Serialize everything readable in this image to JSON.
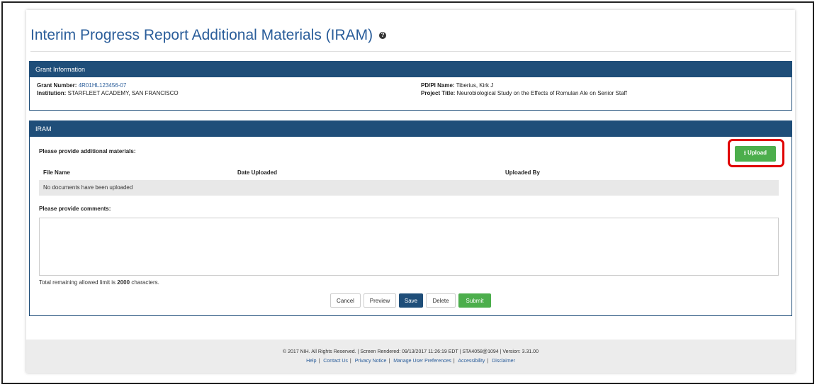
{
  "page": {
    "title": "Interim Progress Report Additional Materials (IRAM)",
    "help_glyph": "?"
  },
  "grant_panel": {
    "header": "Grant Information",
    "grant_number_label": "Grant Number:",
    "grant_number_value": "4R01HL123456-07",
    "institution_label": "Institution:",
    "institution_value": "STARFLEET ACADEMY, SAN FRANCISCO",
    "pdpi_label": "PD/PI Name:",
    "pdpi_value": "Tiberius, Kirk J",
    "project_title_label": "Project Title:",
    "project_title_value": "Neurobiological Study on the Effects of Romulan Ale on Senior Staff"
  },
  "iram_panel": {
    "header": "IRAM",
    "materials_prompt": "Please provide additional materials:",
    "upload_label": "⭳ Upload",
    "columns": [
      "File Name",
      "Date Uploaded",
      "Uploaded By"
    ],
    "empty_message": "No documents have been uploaded",
    "comments_prompt": "Please provide comments:",
    "limit_prefix": "Total remaining allowed limit is",
    "limit_value": "2000",
    "limit_suffix": "characters."
  },
  "actions": {
    "cancel": "Cancel",
    "preview": "Preview",
    "save": "Save",
    "delete": "Delete",
    "submit": "Submit"
  },
  "footer": {
    "text": "© 2017 NIH. All Rights Reserved. | Screen Rendered: 09/13/2017 11:26:19 EDT | STA4058@1094 | Version: 3.31.00",
    "links": [
      "Help",
      "Contact Us",
      "Privacy Notice",
      "Manage User Preferences",
      "Accessibility",
      "Disclaimer"
    ]
  },
  "colors": {
    "header_blue": "#1f4e79",
    "link_blue": "#2a5d9a",
    "upload_green": "#4cae4c",
    "highlight_red": "#e00000"
  }
}
